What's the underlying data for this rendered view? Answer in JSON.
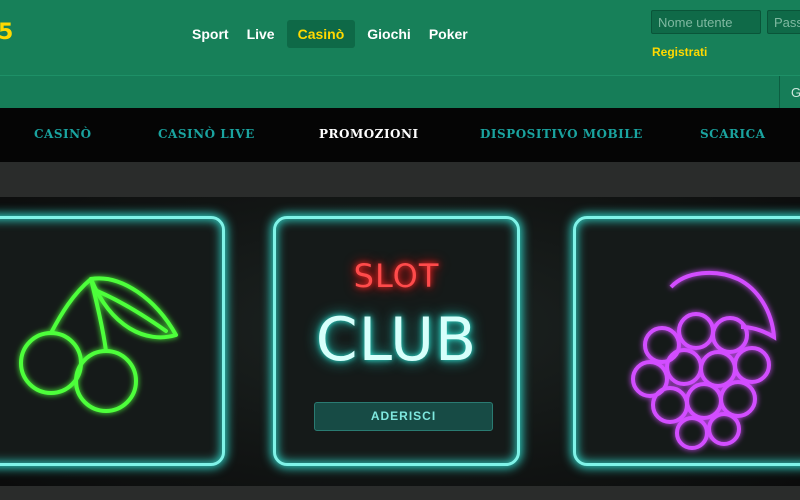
{
  "header": {
    "logo_text": "5",
    "nav": [
      {
        "label": "Sport"
      },
      {
        "label": "Live"
      },
      {
        "label": "Casinò",
        "active": true
      },
      {
        "label": "Giochi"
      },
      {
        "label": "Poker"
      }
    ],
    "login": {
      "username_placeholder": "Nome utente",
      "password_placeholder": "Pass",
      "register_label": "Registrati"
    }
  },
  "substrip": {
    "edge_text": "G"
  },
  "casino_nav": {
    "items": [
      {
        "label": "CASINÒ"
      },
      {
        "label": "CASINÒ LIVE"
      },
      {
        "label": "PROMOZIONI",
        "active": true
      },
      {
        "label": "DISPOSITIVO MOBILE"
      },
      {
        "label": "SCARICA"
      }
    ]
  },
  "banner": {
    "slot_text": "SLOT",
    "club_text": "CLUB",
    "join_button": "ADERISCI"
  },
  "colors": {
    "header_green": "#178059",
    "accent_yellow": "#ffd900",
    "nav_teal": "#1aa39f",
    "neon_cyan": "#7ff3e8",
    "neon_green": "#4dff3a",
    "neon_purple": "#d24dff",
    "neon_red": "#ff4b4b"
  },
  "icons": [
    "cherry-icon",
    "grapes-icon"
  ]
}
